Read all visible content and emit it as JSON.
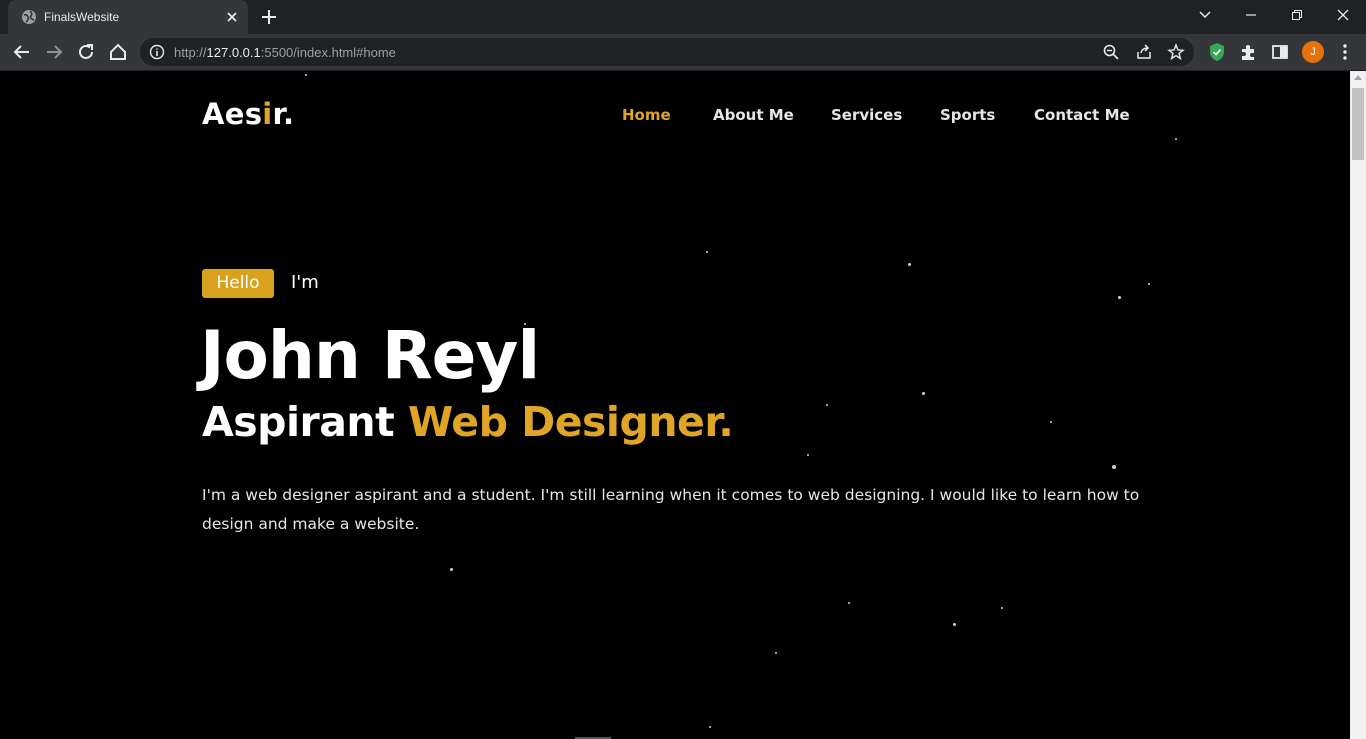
{
  "browser": {
    "tab_title": "FinalsWebsite",
    "url_prefix": "http://",
    "url_host": "127.0.0.1",
    "url_rest": ":5500/index.html#home",
    "profile_initial": "J"
  },
  "site": {
    "logo_main": "Aes",
    "logo_accent": "i",
    "logo_end": "r.",
    "nav": [
      {
        "label": "Home",
        "active": true
      },
      {
        "label": "About Me",
        "active": false
      },
      {
        "label": "Services",
        "active": false
      },
      {
        "label": "Sports",
        "active": false
      },
      {
        "label": "Contact Me",
        "active": false
      }
    ]
  },
  "hero": {
    "badge": "Hello",
    "greeting": "I'm",
    "name": "John Reyl",
    "role_prefix": "Aspirant",
    "role_accent": "Web Designer.",
    "bio": "I'm a web designer aspirant and a student. I'm still learning when it comes to web designing. I would like to learn how to design and make a website."
  },
  "colors": {
    "accent": "#e0a526",
    "badge": "#d9a21e",
    "background": "#000000"
  }
}
